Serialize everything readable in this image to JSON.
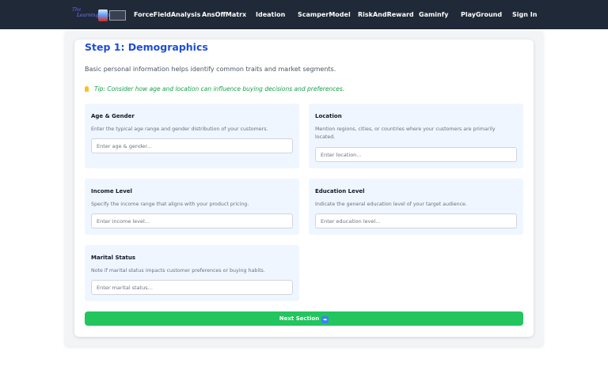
{
  "nav": {
    "logo": {
      "line1": "The",
      "line2": "Learning App"
    },
    "links": [
      "ForceFieldAnalysis",
      "AnsOffMatrx",
      "Ideation",
      "ScamperModel",
      "RiskAndReward",
      "Gaminfy",
      "PlayGround",
      "Sign In"
    ]
  },
  "step": {
    "title": "Step 1: Demographics",
    "subtitle": "Basic personal information helps identify common traits and market segments.",
    "tip": "Tip: Consider how age and location can influence buying decisions and preferences.",
    "tip_icon": "lightbulb-icon"
  },
  "fields": [
    {
      "label": "Age & Gender",
      "help": "Enter the typical age range and gender distribution of your customers.",
      "placeholder": "Enter age & gender...",
      "value": ""
    },
    {
      "label": "Location",
      "help": "Mention regions, cities, or countries where your customers are primarily located.",
      "placeholder": "Enter location...",
      "value": ""
    },
    {
      "label": "Income Level",
      "help": "Specify the income range that aligns with your product pricing.",
      "placeholder": "Enter income level...",
      "value": ""
    },
    {
      "label": "Education Level",
      "help": "Indicate the general education level of your target audience.",
      "placeholder": "Enter education level...",
      "value": ""
    },
    {
      "label": "Marital Status",
      "help": "Note if marital status impacts customer preferences or buying habits.",
      "placeholder": "Enter marital status...",
      "value": ""
    }
  ],
  "next_button": {
    "label": "Next Section",
    "icon": "arrow-right-icon",
    "icon_glyph": "➡"
  },
  "colors": {
    "nav_bg": "#1f2937",
    "title": "#1d4ed8",
    "tip": "#16a34a",
    "field_bg": "#eff6ff",
    "button": "#22c55e"
  }
}
